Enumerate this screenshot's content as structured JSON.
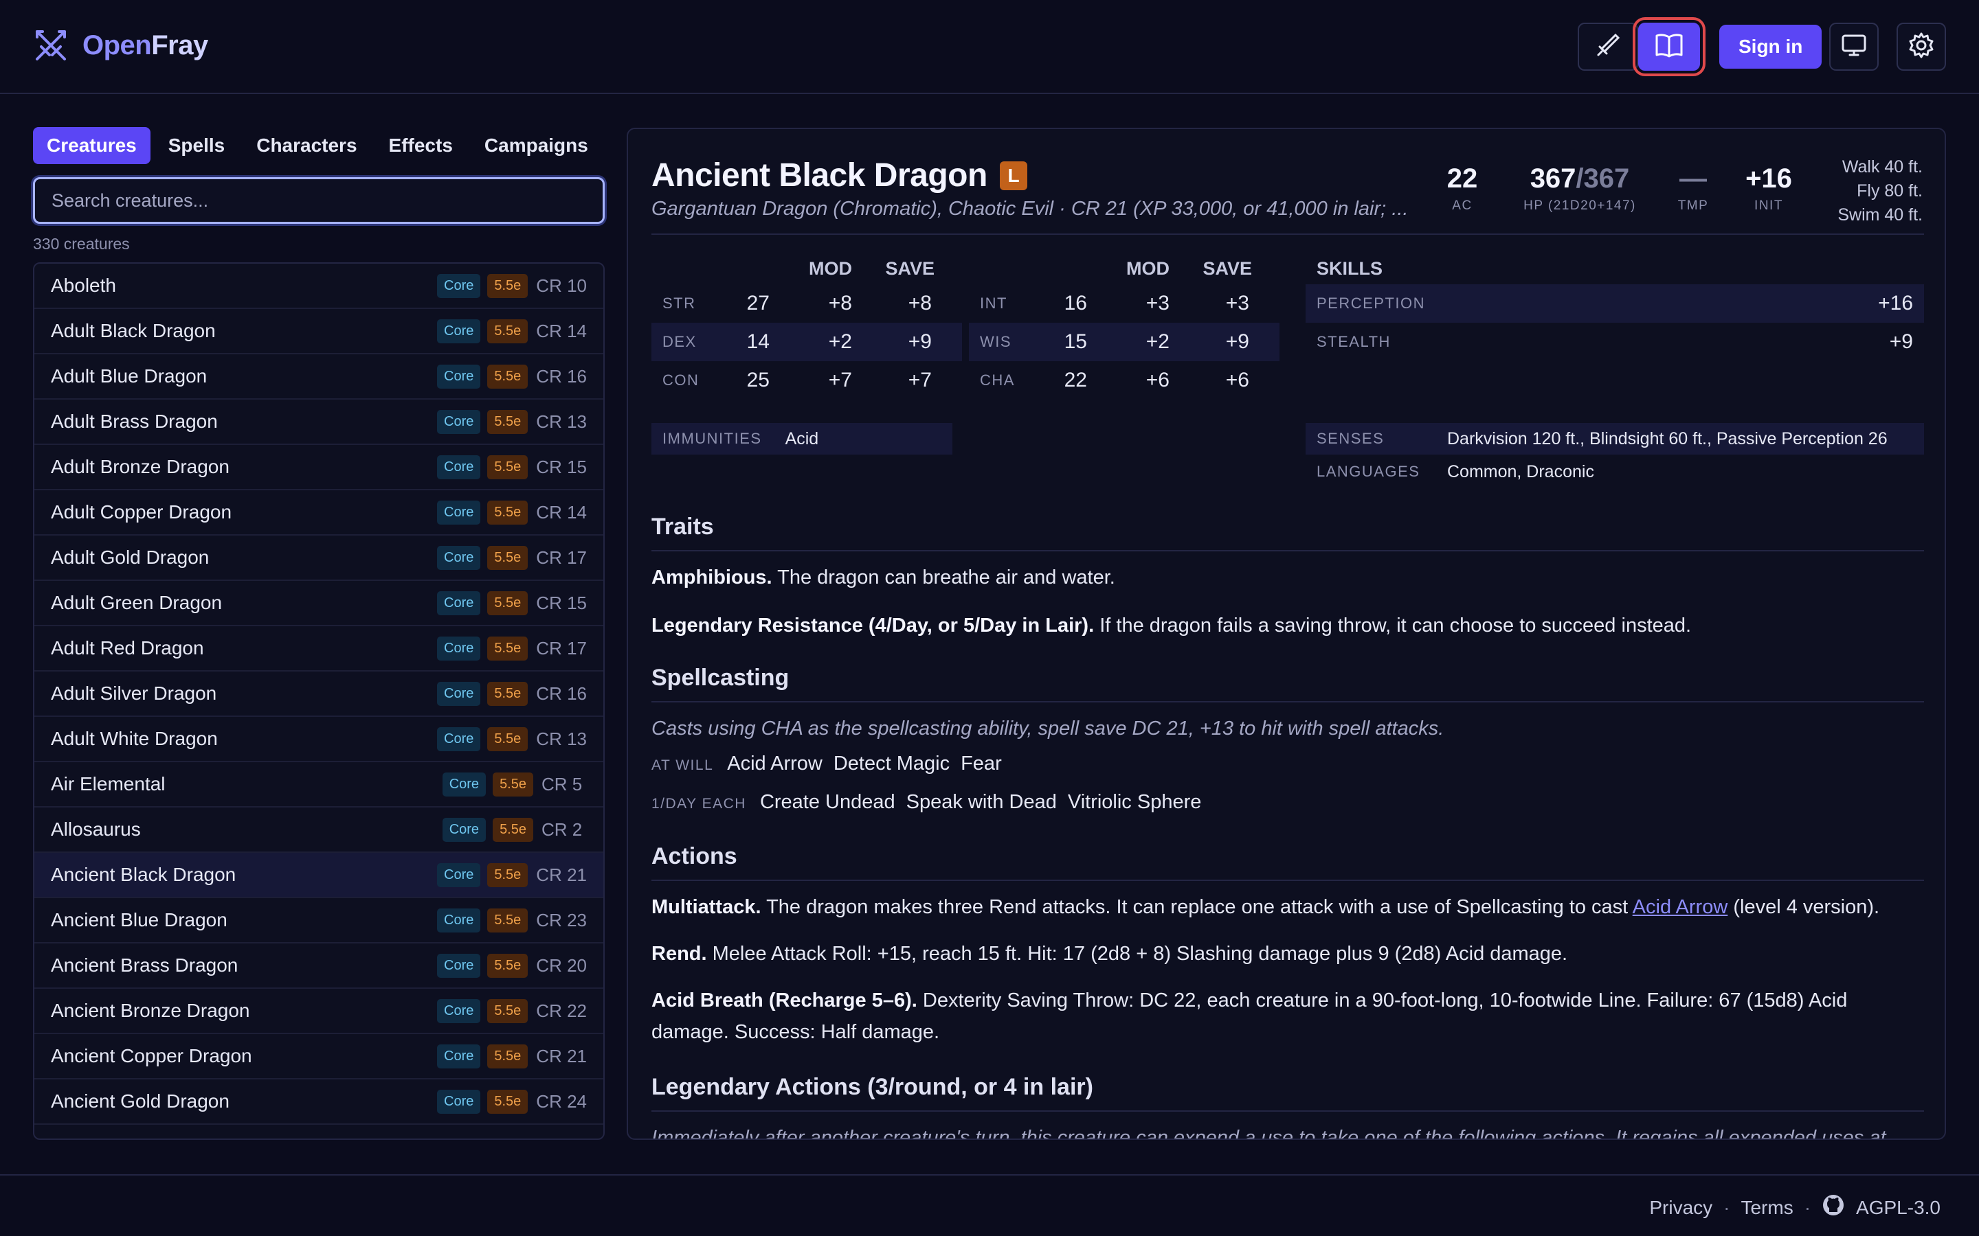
{
  "app": {
    "name_a": "Open",
    "name_b": "Fray"
  },
  "header": {
    "sign_in": "Sign in"
  },
  "tabs": [
    "Creatures",
    "Spells",
    "Characters",
    "Effects",
    "Campaigns"
  ],
  "search": {
    "placeholder": "Search creatures..."
  },
  "list": {
    "count_text": "330 creatures",
    "items": [
      {
        "name": "Aboleth",
        "tag1": "Core",
        "tag2": "5.5e",
        "cr": "CR 10"
      },
      {
        "name": "Adult Black Dragon",
        "tag1": "Core",
        "tag2": "5.5e",
        "cr": "CR 14"
      },
      {
        "name": "Adult Blue Dragon",
        "tag1": "Core",
        "tag2": "5.5e",
        "cr": "CR 16"
      },
      {
        "name": "Adult Brass Dragon",
        "tag1": "Core",
        "tag2": "5.5e",
        "cr": "CR 13"
      },
      {
        "name": "Adult Bronze Dragon",
        "tag1": "Core",
        "tag2": "5.5e",
        "cr": "CR 15"
      },
      {
        "name": "Adult Copper Dragon",
        "tag1": "Core",
        "tag2": "5.5e",
        "cr": "CR 14"
      },
      {
        "name": "Adult Gold Dragon",
        "tag1": "Core",
        "tag2": "5.5e",
        "cr": "CR 17"
      },
      {
        "name": "Adult Green Dragon",
        "tag1": "Core",
        "tag2": "5.5e",
        "cr": "CR 15"
      },
      {
        "name": "Adult Red Dragon",
        "tag1": "Core",
        "tag2": "5.5e",
        "cr": "CR 17"
      },
      {
        "name": "Adult Silver Dragon",
        "tag1": "Core",
        "tag2": "5.5e",
        "cr": "CR 16"
      },
      {
        "name": "Adult White Dragon",
        "tag1": "Core",
        "tag2": "5.5e",
        "cr": "CR 13"
      },
      {
        "name": "Air Elemental",
        "tag1": "Core",
        "tag2": "5.5e",
        "cr": "CR 5"
      },
      {
        "name": "Allosaurus",
        "tag1": "Core",
        "tag2": "5.5e",
        "cr": "CR 2"
      },
      {
        "name": "Ancient Black Dragon",
        "tag1": "Core",
        "tag2": "5.5e",
        "cr": "CR 21"
      },
      {
        "name": "Ancient Blue Dragon",
        "tag1": "Core",
        "tag2": "5.5e",
        "cr": "CR 23"
      },
      {
        "name": "Ancient Brass Dragon",
        "tag1": "Core",
        "tag2": "5.5e",
        "cr": "CR 20"
      },
      {
        "name": "Ancient Bronze Dragon",
        "tag1": "Core",
        "tag2": "5.5e",
        "cr": "CR 22"
      },
      {
        "name": "Ancient Copper Dragon",
        "tag1": "Core",
        "tag2": "5.5e",
        "cr": "CR 21"
      },
      {
        "name": "Ancient Gold Dragon",
        "tag1": "Core",
        "tag2": "5.5e",
        "cr": "CR 24"
      }
    ]
  },
  "creature": {
    "name": "Ancient Black Dragon",
    "legendary_badge": "L",
    "subtitle": "Gargantuan Dragon (Chromatic), Chaotic Evil · CR 21 (XP 33,000, or 41,000 in lair; ...",
    "ac": "22",
    "ac_label": "AC",
    "hp": "367",
    "hp_max": "/367",
    "hp_label": "HP (21D20+147)",
    "tmp": "—",
    "tmp_label": "TMP",
    "init": "+16",
    "init_label": "INIT",
    "speeds": [
      "Walk 40 ft.",
      "Fly 80 ft.",
      "Swim 40 ft."
    ],
    "col_mod": "MOD",
    "col_save": "SAVE",
    "abilities_left": [
      {
        "k": "STR",
        "n": "27",
        "mod": "+8",
        "save": "+8"
      },
      {
        "k": "DEX",
        "n": "14",
        "mod": "+2",
        "save": "+9"
      },
      {
        "k": "CON",
        "n": "25",
        "mod": "+7",
        "save": "+7"
      }
    ],
    "abilities_right": [
      {
        "k": "INT",
        "n": "16",
        "mod": "+3",
        "save": "+3"
      },
      {
        "k": "WIS",
        "n": "15",
        "mod": "+2",
        "save": "+9"
      },
      {
        "k": "CHA",
        "n": "22",
        "mod": "+6",
        "save": "+6"
      }
    ],
    "skills_heading": "SKILLS",
    "skills": [
      {
        "k": "PERCEPTION",
        "v": "+16"
      },
      {
        "k": "STEALTH",
        "v": "+9"
      }
    ],
    "immunities_label": "IMMUNITIES",
    "immunities": "Acid",
    "senses_label": "SENSES",
    "senses": "Darkvision 120 ft., Blindsight 60 ft., Passive Perception 26",
    "languages_label": "LANGUAGES",
    "languages": "Common, Draconic",
    "traits_heading": "Traits",
    "trait1_name": "Amphibious.",
    "trait1_text": " The dragon can breathe air and water.",
    "trait2_name": "Legendary Resistance (4/Day, or 5/Day in Lair).",
    "trait2_text": " If the dragon fails a saving throw, it can choose to succeed instead.",
    "spell_heading": "Spellcasting",
    "spell_intro": "Casts using CHA as the spellcasting ability, spell save DC 21, +13 to hit with spell attacks.",
    "at_will_label": "AT WILL",
    "at_will": [
      "Acid Arrow",
      "Detect Magic",
      "Fear"
    ],
    "daily_label": "1/DAY EACH",
    "daily": [
      "Create Undead",
      "Speak with Dead",
      "Vitriolic Sphere"
    ],
    "actions_heading": "Actions",
    "a1_name": "Multiattack.",
    "a1_text": " The dragon makes three Rend attacks. It can replace one attack with a use of Spellcasting to cast ",
    "a1_link": "Acid Arrow",
    "a1_tail": " (level 4 version).",
    "a2_name": "Rend.",
    "a2_text": " Melee Attack Roll: +15, reach 15 ft. Hit: 17 (2d8 + 8) Slashing damage plus 9 (2d8) Acid damage.",
    "a3_name": "Acid Breath (Recharge 5–6).",
    "a3_text": " Dexterity Saving Throw: DC 22, each creature in a 90-foot-long, 10-footwide Line. Failure: 67 (15d8) Acid damage. Success: Half damage.",
    "legendary_heading": "Legendary Actions (3/round, or 4 in lair)",
    "legendary_intro": "Immediately after another creature's turn, this creature can expend a use to take one of the following actions. It regains all expended uses at"
  },
  "footer": {
    "privacy": "Privacy",
    "terms": "Terms",
    "license": "AGPL-3.0",
    "sep": "·"
  }
}
